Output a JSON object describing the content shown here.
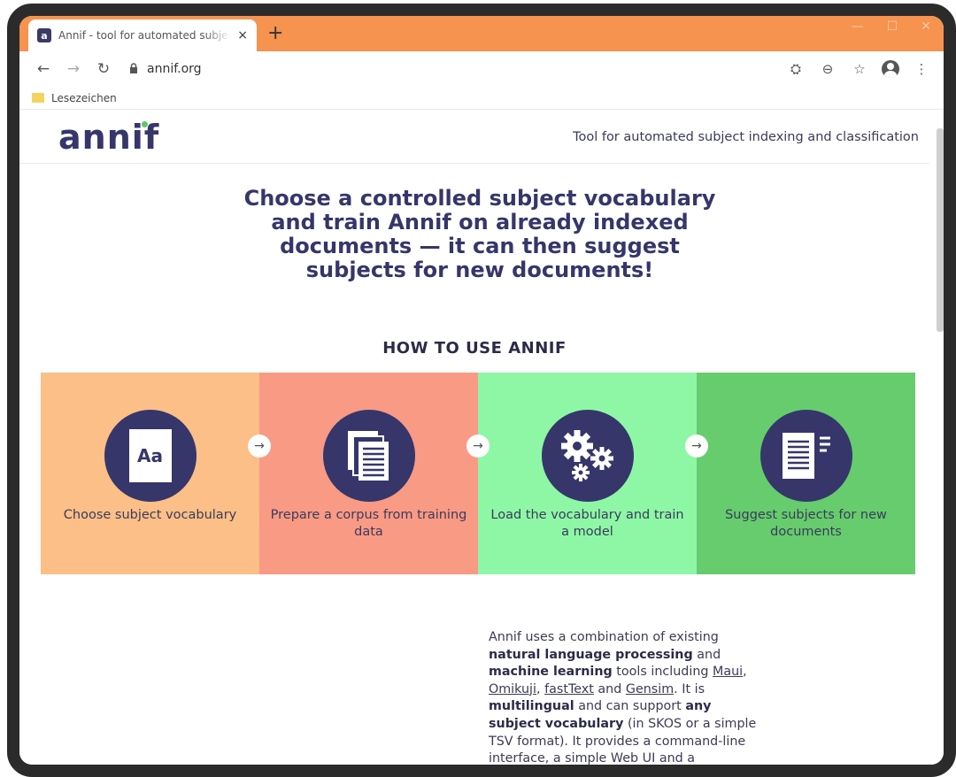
{
  "browser": {
    "tab_title": "Annif - tool for automated subject indexing",
    "tab_favicon": "a",
    "close_glyph": "×",
    "new_tab_glyph": "+",
    "url": "annif.org",
    "bookmark_folder": "Lesezeichen",
    "icons": {
      "back": "←",
      "forward": "→",
      "reload": "↻",
      "lock": "🔒",
      "extension": "⛭",
      "zoom": "⊖",
      "star": "☆",
      "menu": "⋮"
    },
    "window_controls": {
      "minimize": "—",
      "maximize": "☐",
      "close": "✕"
    }
  },
  "site": {
    "logo": "annif",
    "tagline": "Tool for automated subject indexing and classification",
    "hero": "Choose a controlled subject vocabulary and train Annif on already indexed documents — it can then suggest subjects for new documents!",
    "howto_title": "HOW TO USE ANNIF",
    "arrow_glyph": "→",
    "steps": [
      {
        "label": "Choose subject vocabulary",
        "icon": "vocabulary-icon",
        "color": "#fbbf87"
      },
      {
        "label": "Prepare a corpus from training data",
        "icon": "documents-icon",
        "color": "#f99a85"
      },
      {
        "label": "Load the vocabulary and train a model",
        "icon": "gears-icon",
        "color": "#8ef7a6"
      },
      {
        "label": "Suggest subjects for new documents",
        "icon": "suggest-document-icon",
        "color": "#66cc6d"
      }
    ],
    "vocab_icon_text": "Aa",
    "description": {
      "t1": "Annif uses a combination of existing ",
      "b1": "natural language processing",
      "t2": " and ",
      "b2": "machine learning",
      "t3": " tools including ",
      "l1": "Maui",
      "t4": ", ",
      "l2": "Omikuji",
      "t5": ", ",
      "l3": "fastText",
      "t6": " and ",
      "l4": "Gensim",
      "t7": ". It is ",
      "b3": "multilingual",
      "t8": " and can support ",
      "b4": "any subject vocabulary",
      "t9": " (in SKOS or a simple TSV format). It provides a command-line interface, a simple Web UI and a microservice-style REST API."
    }
  }
}
